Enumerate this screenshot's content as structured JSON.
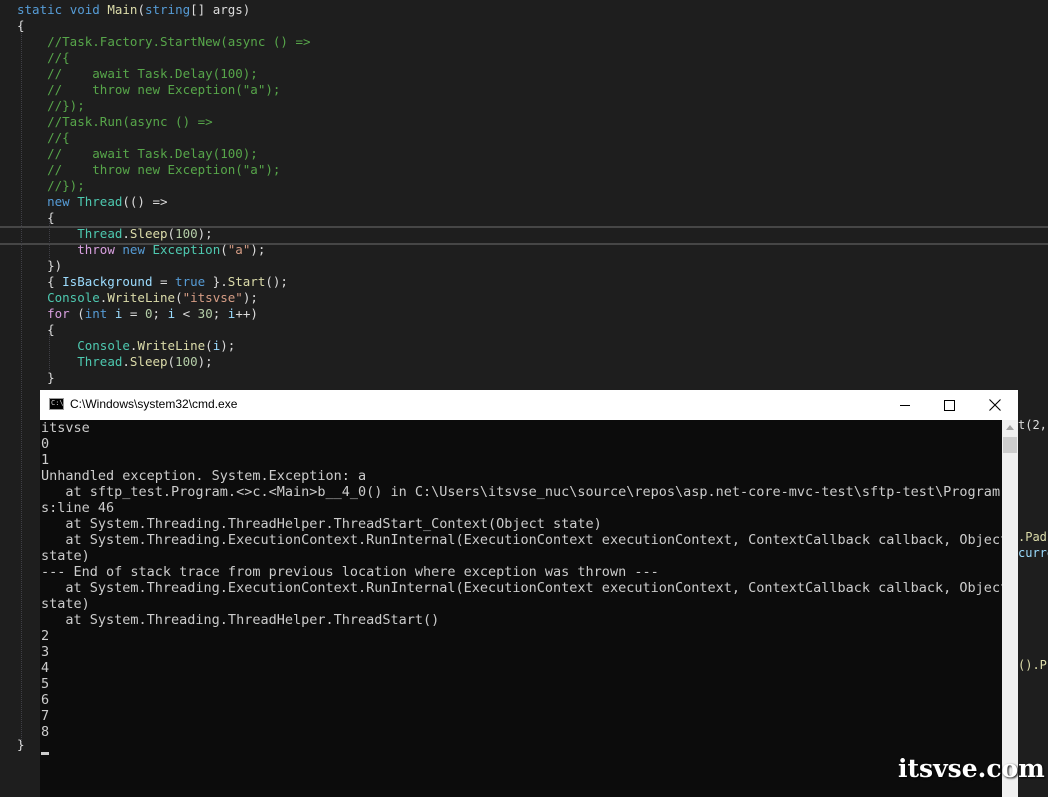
{
  "editor": {
    "lines": [
      [
        [
          "kw",
          "static"
        ],
        [
          "pl",
          " "
        ],
        [
          "kw",
          "void"
        ],
        [
          "pl",
          " "
        ],
        [
          "me",
          "Main"
        ],
        [
          "pl",
          "("
        ],
        [
          "kw",
          "string"
        ],
        [
          "pl",
          "[] args)"
        ]
      ],
      [
        [
          "pl",
          "{"
        ]
      ],
      [
        [
          "pl",
          "    "
        ],
        [
          "cm",
          "//Task.Factory.StartNew(async () =>"
        ]
      ],
      [
        [
          "pl",
          "    "
        ],
        [
          "cm",
          "//{"
        ]
      ],
      [
        [
          "pl",
          "    "
        ],
        [
          "cm",
          "//    await Task.Delay(100);"
        ]
      ],
      [
        [
          "pl",
          "    "
        ],
        [
          "cm",
          "//    throw new Exception(\"a\");"
        ]
      ],
      [
        [
          "pl",
          "    "
        ],
        [
          "cm",
          "//});"
        ]
      ],
      [
        [
          "pl",
          "    "
        ],
        [
          "cm",
          "//Task.Run(async () =>"
        ]
      ],
      [
        [
          "pl",
          "    "
        ],
        [
          "cm",
          "//{"
        ]
      ],
      [
        [
          "pl",
          "    "
        ],
        [
          "cm",
          "//    await Task.Delay(100);"
        ]
      ],
      [
        [
          "pl",
          "    "
        ],
        [
          "cm",
          "//    throw new Exception(\"a\");"
        ]
      ],
      [
        [
          "pl",
          "    "
        ],
        [
          "cm",
          "//});"
        ]
      ],
      [
        [
          "pl",
          "    "
        ],
        [
          "kw",
          "new"
        ],
        [
          "pl",
          " "
        ],
        [
          "ty",
          "Thread"
        ],
        [
          "pl",
          "(() =>"
        ]
      ],
      [
        [
          "pl",
          "    {"
        ]
      ],
      [
        [
          "pl",
          "        "
        ],
        [
          "ty",
          "Thread"
        ],
        [
          "pl",
          "."
        ],
        [
          "me",
          "Sleep"
        ],
        [
          "pl",
          "("
        ],
        [
          "nu",
          "100"
        ],
        [
          "pl",
          ");"
        ]
      ],
      [
        [
          "pl",
          "        "
        ],
        [
          "cf",
          "throw"
        ],
        [
          "pl",
          " "
        ],
        [
          "kw",
          "new"
        ],
        [
          "pl",
          " "
        ],
        [
          "ty",
          "Exception"
        ],
        [
          "pl",
          "("
        ],
        [
          "st",
          "\"a\""
        ],
        [
          "pl",
          ");"
        ]
      ],
      [
        [
          "pl",
          "    })"
        ]
      ],
      [
        [
          "pl",
          "    { "
        ],
        [
          "va",
          "IsBackground"
        ],
        [
          "pl",
          " = "
        ],
        [
          "kw",
          "true"
        ],
        [
          "pl",
          " }."
        ],
        [
          "me",
          "Start"
        ],
        [
          "pl",
          "();"
        ]
      ],
      [
        [
          "pl",
          "    "
        ],
        [
          "ty",
          "Console"
        ],
        [
          "pl",
          "."
        ],
        [
          "me",
          "WriteLine"
        ],
        [
          "pl",
          "("
        ],
        [
          "st",
          "\"itsvse\""
        ],
        [
          "pl",
          ");"
        ]
      ],
      [
        [
          "pl",
          "    "
        ],
        [
          "cf",
          "for"
        ],
        [
          "pl",
          " ("
        ],
        [
          "kw",
          "int"
        ],
        [
          "pl",
          " "
        ],
        [
          "va",
          "i"
        ],
        [
          "pl",
          " = "
        ],
        [
          "nu",
          "0"
        ],
        [
          "pl",
          "; "
        ],
        [
          "va",
          "i"
        ],
        [
          "pl",
          " < "
        ],
        [
          "nu",
          "30"
        ],
        [
          "pl",
          "; "
        ],
        [
          "va",
          "i"
        ],
        [
          "pl",
          "++)"
        ]
      ],
      [
        [
          "pl",
          "    {"
        ]
      ],
      [
        [
          "pl",
          "        "
        ],
        [
          "ty",
          "Console"
        ],
        [
          "pl",
          "."
        ],
        [
          "me",
          "WriteLine"
        ],
        [
          "pl",
          "("
        ],
        [
          "va",
          "i"
        ],
        [
          "pl",
          ");"
        ]
      ],
      [
        [
          "pl",
          "        "
        ],
        [
          "ty",
          "Thread"
        ],
        [
          "pl",
          "."
        ],
        [
          "me",
          "Sleep"
        ],
        [
          "pl",
          "("
        ],
        [
          "nu",
          "100"
        ],
        [
          "pl",
          ");"
        ]
      ],
      [
        [
          "pl",
          "    }"
        ]
      ]
    ],
    "closing_brace": "}",
    "peek_text": [
      {
        "text": "t(2,",
        "cls": "pl"
      },
      {
        "text": ".PadL",
        "cls": "me"
      },
      {
        "text": "curre",
        "cls": "va"
      },
      {
        "text": "().P",
        "cls": "me"
      }
    ]
  },
  "console": {
    "title": "C:\\Windows\\system32\\cmd.exe",
    "icon": "cmd-icon",
    "icon_text": "C:\\",
    "buttons": {
      "minimize": "minimize-icon",
      "maximize": "maximize-icon",
      "close": "close-icon"
    },
    "lines": [
      "itsvse",
      "0",
      "1",
      "Unhandled exception. System.Exception: a",
      "   at sftp_test.Program.<>c.<Main>b__4_0() in C:\\Users\\itsvse_nuc\\source\\repos\\asp.net-core-mvc-test\\sftp-test\\Program.cs",
      "s:line 46",
      "   at System.Threading.ThreadHelper.ThreadStart_Context(Object state)",
      "   at System.Threading.ExecutionContext.RunInternal(ExecutionContext executionContext, ContextCallback callback, Object",
      "state)",
      "--- End of stack trace from previous location where exception was thrown ---",
      "   at System.Threading.ExecutionContext.RunInternal(ExecutionContext executionContext, ContextCallback callback, Object",
      "state)",
      "   at System.Threading.ThreadHelper.ThreadStart()",
      "2",
      "3",
      "4",
      "5",
      "6",
      "7",
      "8"
    ]
  },
  "watermark": "itsvse.com"
}
